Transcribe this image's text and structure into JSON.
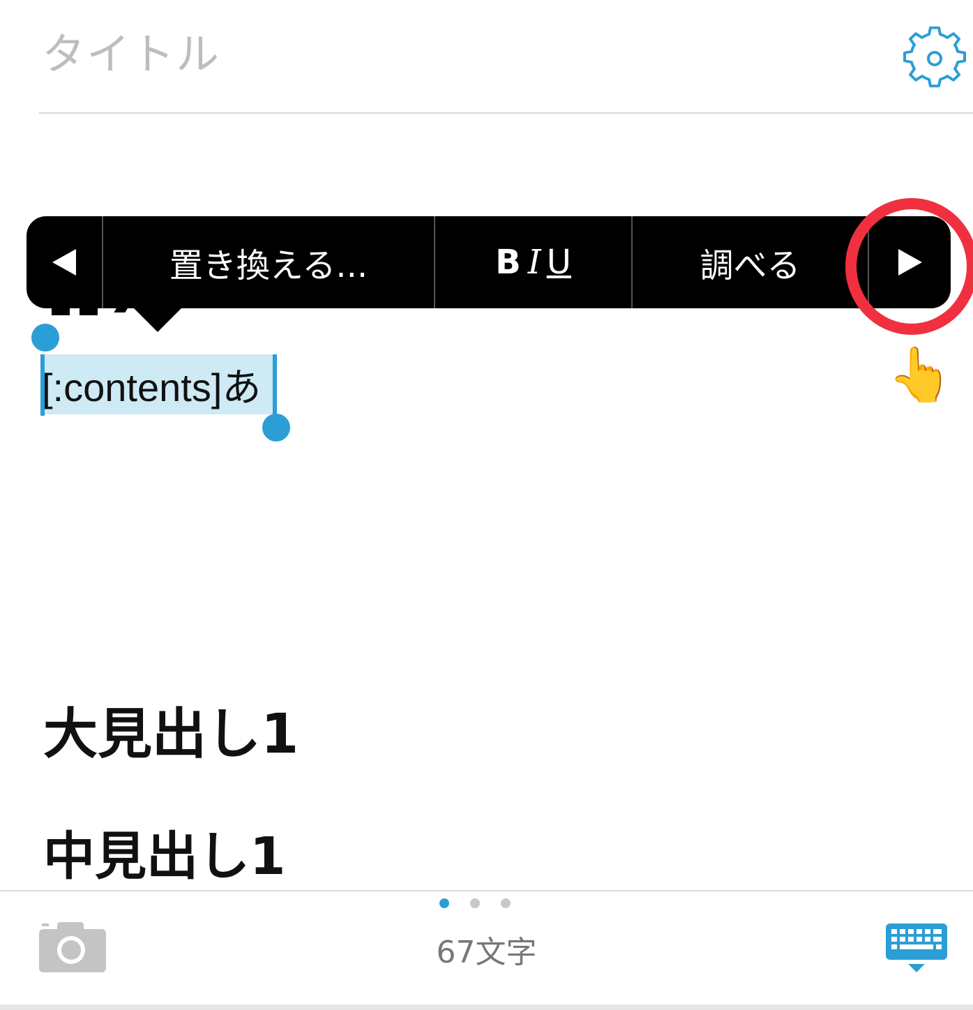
{
  "header": {
    "title_placeholder": "タイトル",
    "settings_icon": "gear-icon"
  },
  "edit_menu": {
    "prev_icon": "triangle-left-icon",
    "replace_label": "置き換える...",
    "biu": {
      "bold": "B",
      "italic": "I",
      "underline": "U"
    },
    "lookup_label": "調べる",
    "next_icon": "triangle-right-icon"
  },
  "editor": {
    "selected_text": "[:contents]あ",
    "heading_large": "大見出し1",
    "heading_medium": "中見出し1"
  },
  "toolbar": {
    "page_indicator": {
      "total": 3,
      "active": 1
    },
    "camera_icon": "camera-icon",
    "char_count": "67文字",
    "keyboard_icon": "keyboard-hide-icon"
  },
  "annotation": {
    "highlight_color": "#f0303f",
    "pointer_emoji": "👆"
  },
  "colors": {
    "accent": "#2b9ed6",
    "selection": "#cdeaf5",
    "placeholder": "#bdbdbd"
  }
}
